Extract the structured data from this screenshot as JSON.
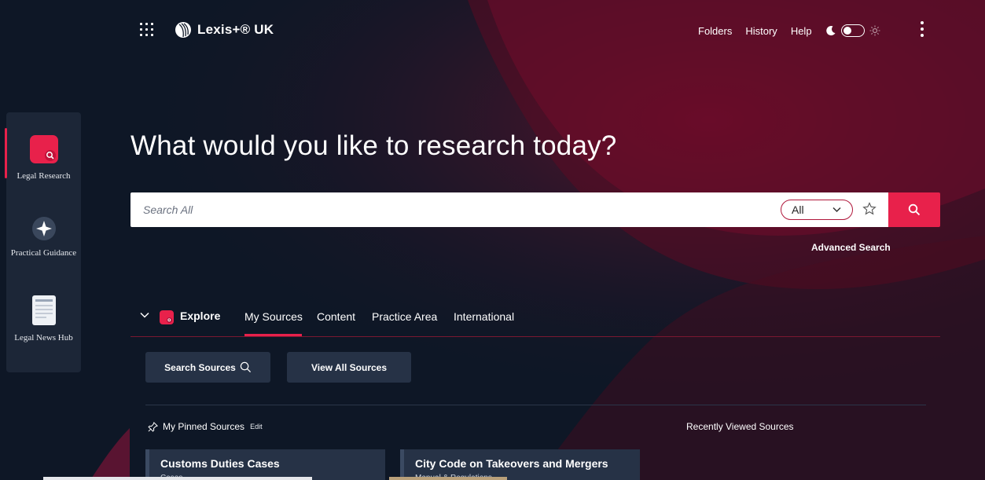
{
  "brand": {
    "name": "Lexis+® UK"
  },
  "top_nav": {
    "links": [
      "Folders",
      "History",
      "Help"
    ]
  },
  "icons": {
    "apps": "apps-grid-icon",
    "theme_dark": "moon-icon",
    "theme_light": "sun-icon",
    "more": "kebab-menu-icon",
    "search": "search-icon",
    "favorite": "star-icon"
  },
  "colors": {
    "accent": "#e8214b",
    "background": "#0e1726",
    "rail": "#1c2637",
    "tile": "#263246"
  },
  "rail": {
    "items": [
      {
        "label": "Legal Research",
        "icon": "legal-research-icon",
        "active": true
      },
      {
        "label": "Practical Guidance",
        "icon": "compass-star-icon",
        "active": false
      },
      {
        "label": "Legal News Hub",
        "icon": "newspaper-icon",
        "active": false
      }
    ]
  },
  "hero": {
    "title": "What would you like to research today?"
  },
  "search": {
    "placeholder": "Search All",
    "value": "",
    "scope": "All",
    "advanced": "Advanced Search"
  },
  "explore": {
    "label": "Explore",
    "tabs": [
      "My Sources",
      "Content",
      "Practice Area",
      "International"
    ],
    "active_tab": "My Sources",
    "buttons": {
      "search_sources": "Search Sources",
      "view_all": "View All Sources"
    }
  },
  "pinned": {
    "title": "My Pinned Sources",
    "edit": "Edit",
    "cards": [
      {
        "title": "Customs Duties Cases",
        "subtitle": "Cases"
      },
      {
        "title": "City Code on Takeovers and Mergers",
        "subtitle": "Manual & Regulations"
      }
    ]
  },
  "recent": {
    "title": "Recently Viewed Sources"
  }
}
